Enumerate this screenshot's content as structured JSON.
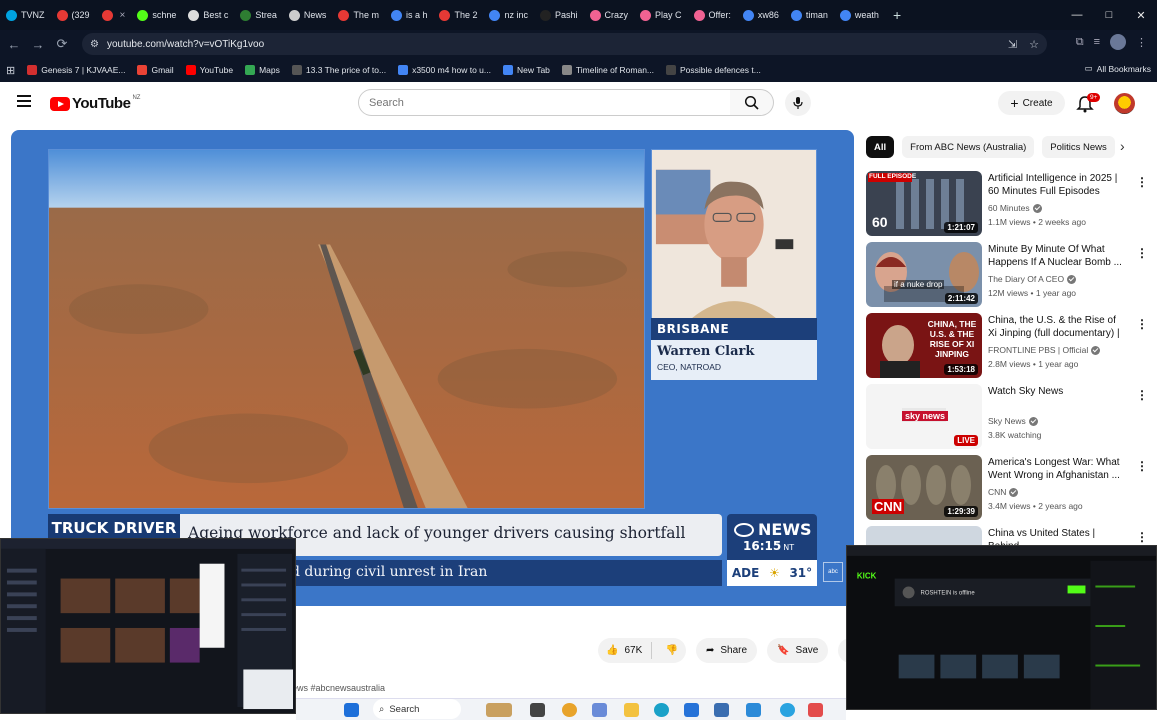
{
  "browser": {
    "tabs": [
      {
        "title": "TVNZ",
        "color": "#00a3e0"
      },
      {
        "title": "(329",
        "color": "#e53935"
      },
      {
        "title": "",
        "color": "#e53935",
        "close": "×"
      },
      {
        "title": "schne",
        "color": "#53fc18"
      },
      {
        "title": "Best c",
        "color": "#ddd"
      },
      {
        "title": "Strea",
        "color": "#2e7d32"
      },
      {
        "title": "News",
        "color": "#ccc"
      },
      {
        "title": "The m",
        "color": "#e53935"
      },
      {
        "title": "is a h",
        "color": "#4285f4"
      },
      {
        "title": "The 2",
        "color": "#e53935"
      },
      {
        "title": "nz inc",
        "color": "#4285f4"
      },
      {
        "title": "Pashi",
        "color": "#222"
      },
      {
        "title": "Crazy",
        "color": "#f06292"
      },
      {
        "title": "Play C",
        "color": "#f06292"
      },
      {
        "title": "Offer:",
        "color": "#f06292"
      },
      {
        "title": "xw86",
        "color": "#4285f4"
      },
      {
        "title": "timan",
        "color": "#4285f4"
      },
      {
        "title": "weath",
        "color": "#4285f4"
      }
    ],
    "new_tab": "+",
    "window_controls": {
      "minimize": "—",
      "maximize": "□",
      "close": "✕"
    },
    "url": "youtube.com/watch?v=vOTiKg1voo",
    "bookmarks": [
      {
        "label": "Genesis 7 | KJVAAE...",
        "color": "#d32f2f"
      },
      {
        "label": "Gmail",
        "color": "#ea4335"
      },
      {
        "label": "YouTube",
        "color": "#ff0000"
      },
      {
        "label": "Maps",
        "color": "#34a853"
      },
      {
        "label": "13.3 The price of to...",
        "color": "#555"
      },
      {
        "label": "x3500 m4 how to u...",
        "color": "#4285f4"
      },
      {
        "label": "New Tab",
        "color": "#4285f4"
      },
      {
        "label": "Timeline of Roman...",
        "color": "#888"
      },
      {
        "label": "Possible defences t...",
        "color": "#444"
      }
    ],
    "all_bookmarks": "All Bookmarks"
  },
  "youtube": {
    "logo_text": "YouTube",
    "country_code": "NZ",
    "search_placeholder": "Search",
    "create_label": "Create",
    "notification_count": "9+",
    "player": {
      "location": "BRISBANE",
      "person_name": "Warren Clark",
      "person_title": "CEO, NATROAD",
      "tag": "TRUCK DRIVER",
      "headline": "Ageing workforce and lack of younger drivers causing shortfall",
      "ticker": "d during civil unrest in Iran",
      "network": "NEWS",
      "time": "16:15",
      "timezone": "NT",
      "weather_city": "ADE",
      "temperature": "31°"
    },
    "actions": {
      "likes": "67K",
      "share": "Share",
      "save": "Save"
    },
    "hashtag": "ews #abcnewsaustralia",
    "chips": [
      "All",
      "From ABC News (Australia)",
      "Politics News"
    ],
    "recommendations": [
      {
        "title": "Artificial Intelligence in 2025 | 60 Minutes Full Episodes",
        "channel": "60 Minutes",
        "verified": true,
        "meta": "1.1M views • 2 weeks ago",
        "duration": "1:21:07",
        "thumb": "#3a4250",
        "badge": "FULL EPISODE"
      },
      {
        "title": "Minute By Minute Of What Happens If A Nuclear Bomb ...",
        "channel": "The Diary Of A CEO",
        "verified": true,
        "meta": "12M views • 1 year ago",
        "duration": "2:11:42",
        "thumb": "#6a7f99",
        "badge": ""
      },
      {
        "title": "China, the U.S. & the Rise of Xi Jinping (full documentary) | ...",
        "channel": "FRONTLINE PBS | Official",
        "verified": true,
        "meta": "2.8M views • 1 year ago",
        "duration": "1:53:18",
        "thumb": "#8a1f1f",
        "badge": ""
      },
      {
        "title": "Watch Sky News",
        "channel": "Sky News",
        "verified": true,
        "meta": "3.8K watching",
        "duration": "LIVE",
        "thumb": "#f3f3f3",
        "badge": ""
      },
      {
        "title": "America's Longest War: What Went Wrong in Afghanistan ...",
        "channel": "CNN",
        "verified": true,
        "meta": "3.4M views • 2 years ago",
        "duration": "1:29:39",
        "thumb": "#7a6a5a",
        "badge": ""
      },
      {
        "title": "China vs United States | Behind",
        "channel": "",
        "verified": false,
        "meta": "",
        "duration": "",
        "thumb": "#cfd7e0",
        "badge": ""
      }
    ]
  },
  "thumb_texts": {
    "t1": "60",
    "t2": "if a nuke drop",
    "t3": "CHINA, THE U.S. & THE RISE OF XI JINPING",
    "t4": "sky news",
    "t5": "CNN"
  },
  "overlay_right": {
    "label": "ROSHTEIN is offline"
  },
  "taskbar": {
    "search_label": "Search"
  }
}
